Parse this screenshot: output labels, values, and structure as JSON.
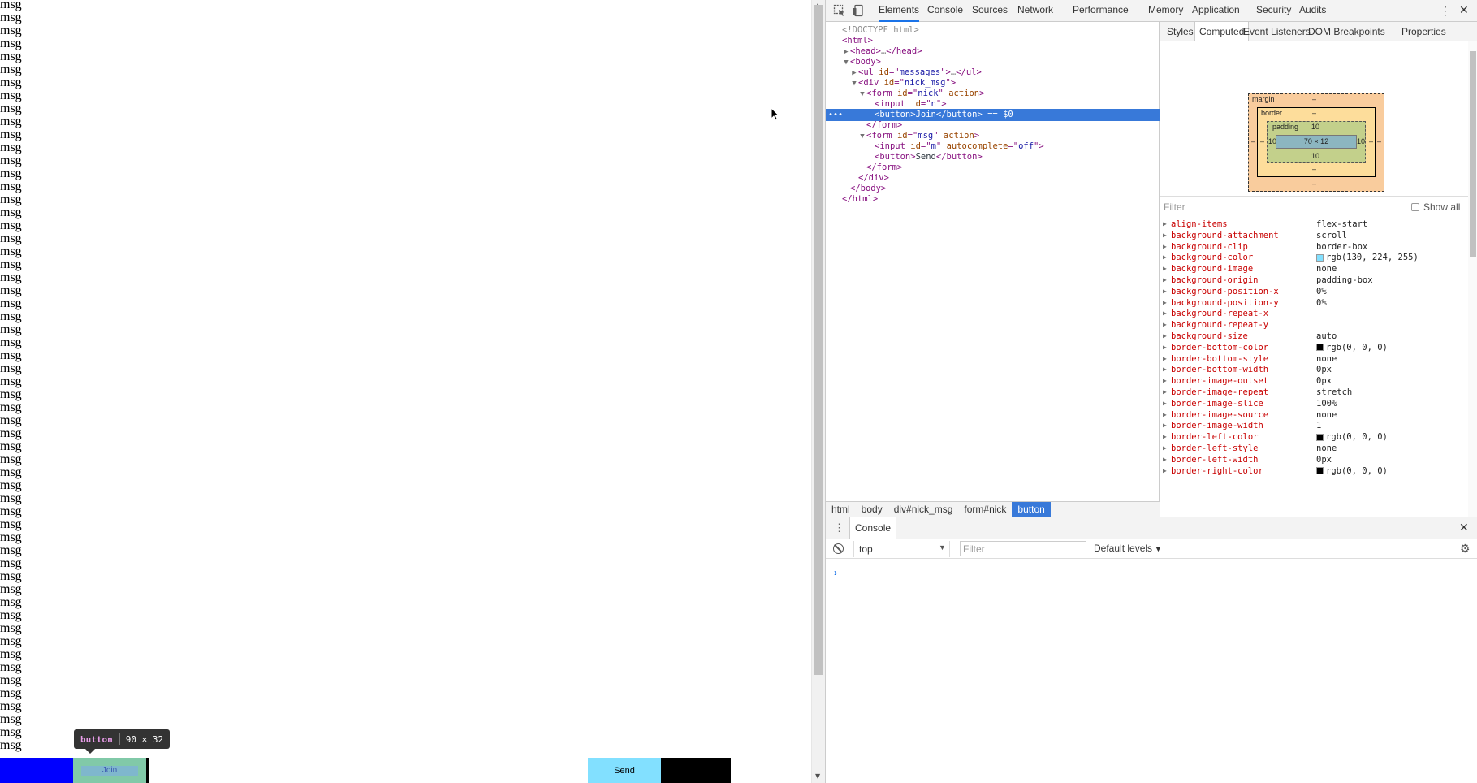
{
  "page": {
    "messages": [
      "msg",
      "msg",
      "msg",
      "msg",
      "msg",
      "msg",
      "msg",
      "msg",
      "msg",
      "msg",
      "msg",
      "msg",
      "msg",
      "msg",
      "msg",
      "msg",
      "msg",
      "msg",
      "msg",
      "msg",
      "msg",
      "msg",
      "msg",
      "msg",
      "msg",
      "msg",
      "msg",
      "msg",
      "msg",
      "msg",
      "msg",
      "msg",
      "msg",
      "msg",
      "msg",
      "msg",
      "msg",
      "msg",
      "msg",
      "msg",
      "msg",
      "msg",
      "msg",
      "msg",
      "msg",
      "msg",
      "msg",
      "msg",
      "msg",
      "msg",
      "msg",
      "msg",
      "msg",
      "msg",
      "msg",
      "msg",
      "msg",
      "msg"
    ],
    "join_label": "Join",
    "send_label": "Send",
    "tooltip": {
      "tag": "button",
      "size": "90 × 32"
    },
    "colors": {
      "nick_bar": "#0000ff",
      "join_button": "#81c9a8",
      "send_button": "#82e0ff"
    }
  },
  "devtools": {
    "tabs": [
      "Elements",
      "Console",
      "Sources",
      "Network",
      "Performance",
      "Memory",
      "Application",
      "Security",
      "Audits"
    ],
    "active_tab": "Elements",
    "dom_tree": [
      {
        "depth": 0,
        "tw": "",
        "parts": [
          [
            "g",
            "<!DOCTYPE html>"
          ]
        ]
      },
      {
        "depth": 0,
        "tw": "",
        "parts": [
          [
            "t",
            "<html>"
          ]
        ]
      },
      {
        "depth": 1,
        "tw": "▶",
        "parts": [
          [
            "t",
            "<head>"
          ],
          [
            "g",
            "…"
          ],
          [
            "t",
            "</head>"
          ]
        ]
      },
      {
        "depth": 1,
        "tw": "▼",
        "parts": [
          [
            "t",
            "<body>"
          ]
        ]
      },
      {
        "depth": 2,
        "tw": "▶",
        "parts": [
          [
            "t",
            "<ul "
          ],
          [
            "a",
            "id"
          ],
          [
            "t",
            "=\""
          ],
          [
            "v",
            "messages"
          ],
          [
            "t",
            "\">"
          ],
          [
            "g",
            "…"
          ],
          [
            "t",
            "</ul>"
          ]
        ]
      },
      {
        "depth": 2,
        "tw": "▼",
        "parts": [
          [
            "t",
            "<div "
          ],
          [
            "a",
            "id"
          ],
          [
            "t",
            "=\""
          ],
          [
            "v",
            "nick_msg"
          ],
          [
            "t",
            "\">"
          ]
        ]
      },
      {
        "depth": 3,
        "tw": "▼",
        "parts": [
          [
            "t",
            "<form "
          ],
          [
            "a",
            "id"
          ],
          [
            "t",
            "=\""
          ],
          [
            "v",
            "nick"
          ],
          [
            "t",
            "\" "
          ],
          [
            "a",
            "action"
          ],
          [
            "t",
            ">"
          ]
        ]
      },
      {
        "depth": 4,
        "tw": "",
        "parts": [
          [
            "t",
            "<input "
          ],
          [
            "a",
            "id"
          ],
          [
            "t",
            "=\""
          ],
          [
            "v",
            "n"
          ],
          [
            "t",
            "\">"
          ]
        ]
      },
      {
        "depth": 4,
        "tw": "",
        "sel": true,
        "parts": [
          [
            "t",
            "<button>"
          ],
          [
            "p",
            "Join"
          ],
          [
            "t",
            "</button>"
          ],
          [
            "g",
            " == $0"
          ]
        ]
      },
      {
        "depth": 3,
        "tw": "",
        "parts": [
          [
            "t",
            "</form>"
          ]
        ]
      },
      {
        "depth": 3,
        "tw": "▼",
        "parts": [
          [
            "t",
            "<form "
          ],
          [
            "a",
            "id"
          ],
          [
            "t",
            "=\""
          ],
          [
            "v",
            "msg"
          ],
          [
            "t",
            "\" "
          ],
          [
            "a",
            "action"
          ],
          [
            "t",
            ">"
          ]
        ]
      },
      {
        "depth": 4,
        "tw": "",
        "parts": [
          [
            "t",
            "<input "
          ],
          [
            "a",
            "id"
          ],
          [
            "t",
            "=\""
          ],
          [
            "v",
            "m"
          ],
          [
            "t",
            "\" "
          ],
          [
            "a",
            "autocomplete"
          ],
          [
            "t",
            "=\""
          ],
          [
            "v",
            "off"
          ],
          [
            "t",
            "\">"
          ]
        ]
      },
      {
        "depth": 4,
        "tw": "",
        "parts": [
          [
            "t",
            "<button>"
          ],
          [
            "p",
            "Send"
          ],
          [
            "t",
            "</button>"
          ]
        ]
      },
      {
        "depth": 3,
        "tw": "",
        "parts": [
          [
            "t",
            "</form>"
          ]
        ]
      },
      {
        "depth": 2,
        "tw": "",
        "parts": [
          [
            "t",
            "</div>"
          ]
        ]
      },
      {
        "depth": 1,
        "tw": "",
        "parts": [
          [
            "t",
            "</body>"
          ]
        ]
      },
      {
        "depth": 0,
        "tw": "",
        "parts": [
          [
            "t",
            "</html>"
          ]
        ]
      }
    ],
    "breadcrumbs": [
      "html",
      "body",
      "div#nick_msg",
      "form#nick",
      "button"
    ],
    "active_breadcrumb": "button",
    "side_tabs": [
      "Styles",
      "Computed",
      "Event Listeners",
      "DOM Breakpoints",
      "Properties"
    ],
    "active_side_tab": "Computed",
    "box_model": {
      "margin_label": "margin",
      "margin_top": "–",
      "margin_bottom": "–",
      "margin_left": "–",
      "margin_right": "–",
      "border_label": "border",
      "border_top": "–",
      "border_bottom": "–",
      "border_left": "–",
      "border_right": "–",
      "padding_label": "padding",
      "padding_top": "10",
      "padding_bottom": "10",
      "padding_left": "10",
      "padding_right": "10",
      "content": "70 × 12"
    },
    "filter_placeholder": "Filter",
    "show_all_label": "Show all",
    "computed": [
      {
        "name": "align-items",
        "value": "flex-start"
      },
      {
        "name": "background-attachment",
        "value": "scroll"
      },
      {
        "name": "background-clip",
        "value": "border-box"
      },
      {
        "name": "background-color",
        "value": "rgb(130, 224, 255)",
        "swatch": "#82e0ff"
      },
      {
        "name": "background-image",
        "value": "none"
      },
      {
        "name": "background-origin",
        "value": "padding-box"
      },
      {
        "name": "background-position-x",
        "value": "0%"
      },
      {
        "name": "background-position-y",
        "value": "0%"
      },
      {
        "name": "background-repeat-x",
        "value": ""
      },
      {
        "name": "background-repeat-y",
        "value": ""
      },
      {
        "name": "background-size",
        "value": "auto"
      },
      {
        "name": "border-bottom-color",
        "value": "rgb(0, 0, 0)",
        "swatch": "#000000"
      },
      {
        "name": "border-bottom-style",
        "value": "none"
      },
      {
        "name": "border-bottom-width",
        "value": "0px"
      },
      {
        "name": "border-image-outset",
        "value": "0px"
      },
      {
        "name": "border-image-repeat",
        "value": "stretch"
      },
      {
        "name": "border-image-slice",
        "value": "100%"
      },
      {
        "name": "border-image-source",
        "value": "none"
      },
      {
        "name": "border-image-width",
        "value": "1"
      },
      {
        "name": "border-left-color",
        "value": "rgb(0, 0, 0)",
        "swatch": "#000000"
      },
      {
        "name": "border-left-style",
        "value": "none"
      },
      {
        "name": "border-left-width",
        "value": "0px"
      },
      {
        "name": "border-right-color",
        "value": "rgb(0, 0, 0)",
        "swatch": "#000000"
      }
    ],
    "console": {
      "tab_label": "Console",
      "context": "top",
      "filter_placeholder": "Filter",
      "levels": "Default levels",
      "prompt": "›"
    }
  }
}
